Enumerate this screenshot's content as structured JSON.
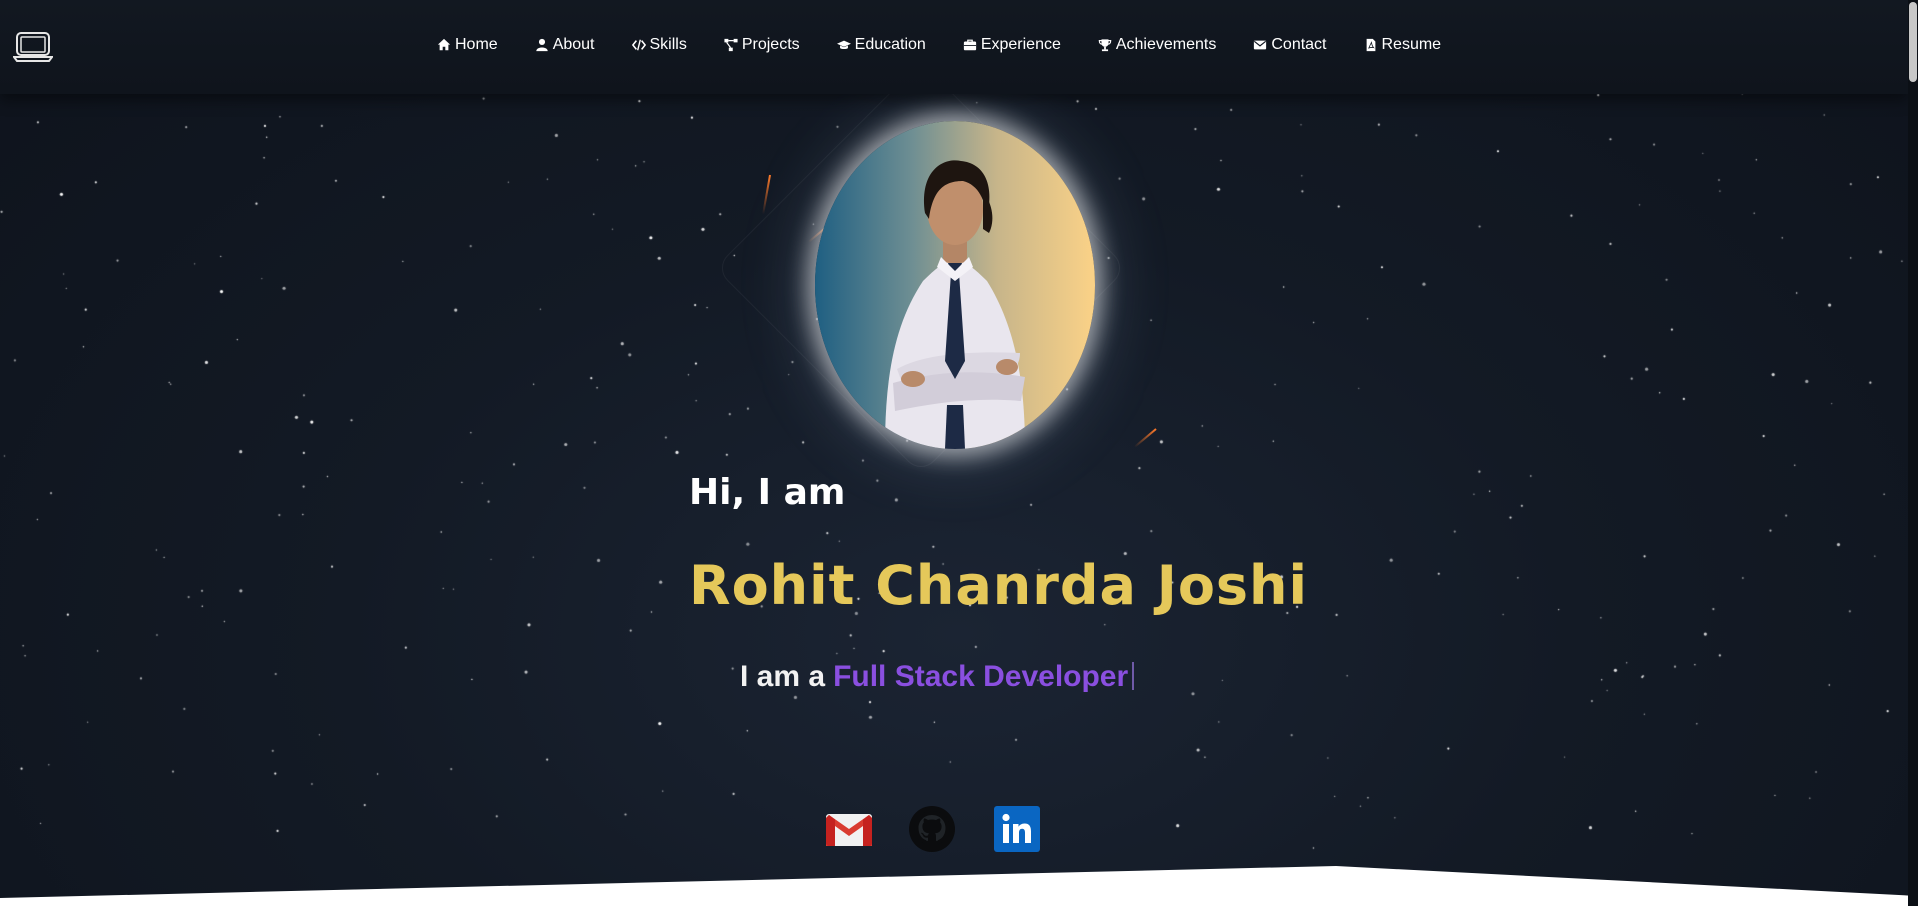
{
  "nav": {
    "logo_icon": "laptop-icon",
    "items": [
      {
        "label": "Home",
        "icon": "home-icon"
      },
      {
        "label": "About",
        "icon": "user-icon"
      },
      {
        "label": "Skills",
        "icon": "code-icon"
      },
      {
        "label": "Projects",
        "icon": "project-diagram-icon"
      },
      {
        "label": "Education",
        "icon": "graduation-cap-icon"
      },
      {
        "label": "Experience",
        "icon": "briefcase-icon"
      },
      {
        "label": "Achievements",
        "icon": "trophy-icon"
      },
      {
        "label": "Contact",
        "icon": "envelope-icon"
      },
      {
        "label": "Resume",
        "icon": "file-pdf-icon"
      }
    ]
  },
  "hero": {
    "greeting": "Hi, I am",
    "name": "Rohit Chanrda Joshi",
    "tagline_prefix": "I am a",
    "tagline_role": "Full Stack Developer"
  },
  "social": [
    {
      "icon": "gmail-icon"
    },
    {
      "icon": "github-icon"
    },
    {
      "icon": "linkedin-icon"
    }
  ],
  "colors": {
    "name": "#e5c85a",
    "role": "#8a4fe0",
    "background": "#131a25"
  }
}
